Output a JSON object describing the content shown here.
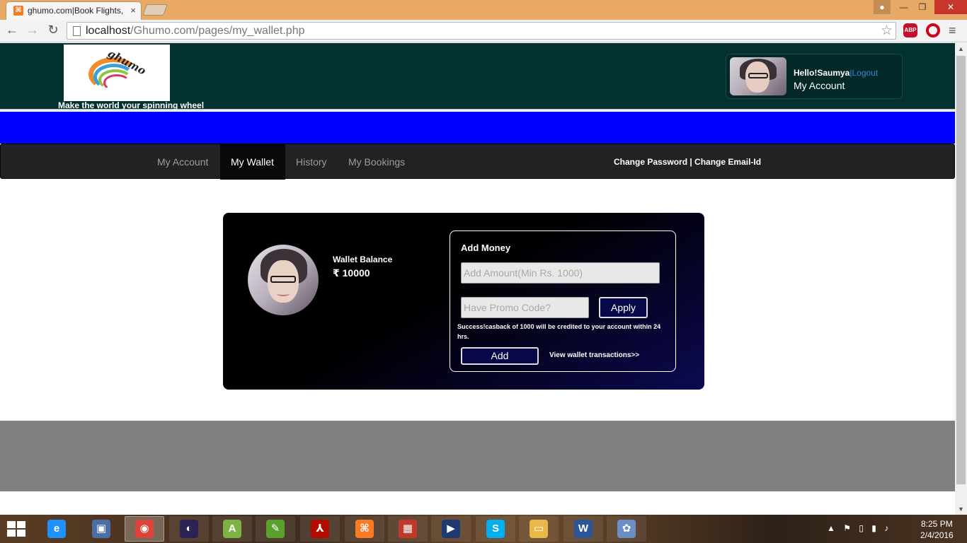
{
  "browser": {
    "tab_title": "ghumo.com|Book Flights,",
    "tab_close": "×",
    "url_host": "localhost",
    "url_path": "/Ghumo.com/pages/my_wallet.php",
    "abp_label": "ABP",
    "icons": [
      "back-icon",
      "forward-icon",
      "reload-icon",
      "star-icon",
      "menu-icon"
    ]
  },
  "header": {
    "logo_text": "ghumo",
    "tagline": "Make the world your spinning wheel",
    "greeting": "Hello!Saumya",
    "separator": "|",
    "logout": "Logout",
    "my_account": "My Account"
  },
  "navbar": {
    "items": [
      {
        "label": "My Account"
      },
      {
        "label": "My Wallet"
      },
      {
        "label": "History"
      },
      {
        "label": "My Bookings"
      }
    ],
    "active_index": 1,
    "right_links": "Change Password | Change Email-Id"
  },
  "wallet": {
    "balance_label": "Wallet Balance",
    "balance_value": "₹ 10000",
    "add_title": "Add Money",
    "amount_placeholder": "Add Amount(Min Rs. 1000)",
    "promo_placeholder": "Have Promo Code?",
    "apply_label": "Apply",
    "promo_message": "Success!casback of 1000 will be credited to your account within 24 hrs.",
    "add_label": "Add",
    "view_transactions": "View wallet transactions>>"
  },
  "taskbar": {
    "apps": [
      {
        "name": "ie-icon",
        "glyph": "e",
        "color": "#1e90ff"
      },
      {
        "name": "computer-icon",
        "glyph": "▣",
        "color": "#4a6fa5"
      },
      {
        "name": "chrome-icon",
        "glyph": "◉",
        "color": "#db4437"
      },
      {
        "name": "eclipse-icon",
        "glyph": "◐",
        "color": "#2c2255"
      },
      {
        "name": "android-studio-icon",
        "glyph": "A",
        "color": "#7cb342"
      },
      {
        "name": "notepad-icon",
        "glyph": "✎",
        "color": "#5aa02c"
      },
      {
        "name": "acrobat-icon",
        "glyph": "⅄",
        "color": "#b30b00"
      },
      {
        "name": "xampp-icon",
        "glyph": "⌘",
        "color": "#fb7a24"
      },
      {
        "name": "windows-store-icon",
        "glyph": "▦",
        "color": "#c0392b"
      },
      {
        "name": "media-player-icon",
        "glyph": "▶",
        "color": "#1f3a70"
      },
      {
        "name": "skype-icon",
        "glyph": "S",
        "color": "#00aff0"
      },
      {
        "name": "file-explorer-icon",
        "glyph": "▭",
        "color": "#e8b84a"
      },
      {
        "name": "word-icon",
        "glyph": "W",
        "color": "#2b579a"
      },
      {
        "name": "paint-icon",
        "glyph": "✿",
        "color": "#6b8ec7"
      }
    ],
    "time": "8:25 PM",
    "date": "2/4/2016"
  }
}
